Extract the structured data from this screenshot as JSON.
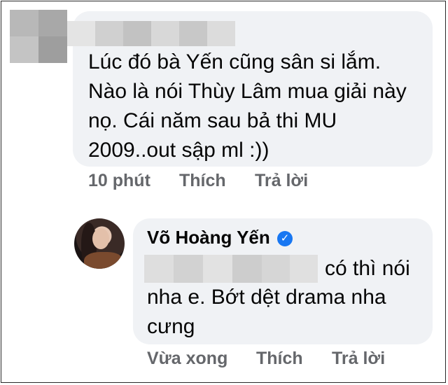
{
  "comment": {
    "text": "Lúc đó bà Yến cũng sân si lắm. Nào là nói Thùy Lâm mua giải này nọ. Cái năm sau bả thi MU 2009..out sập ml :))",
    "actions": {
      "time": "10 phút",
      "like": "Thích",
      "reply": "Trả lời"
    }
  },
  "reply": {
    "author": "Võ Hoàng Yến",
    "text_first_line": "có thì nói",
    "text_rest": "nha e. Bớt dệt drama nha cưng",
    "actions": {
      "time": "Vừa xong",
      "like": "Thích",
      "reply": "Trả lời"
    }
  },
  "colors": {
    "bubble": "#f0f2f5",
    "text": "#050505",
    "meta": "#65676b",
    "verified": "#1877f2"
  },
  "icons": {
    "verified": "verified-badge-icon"
  }
}
